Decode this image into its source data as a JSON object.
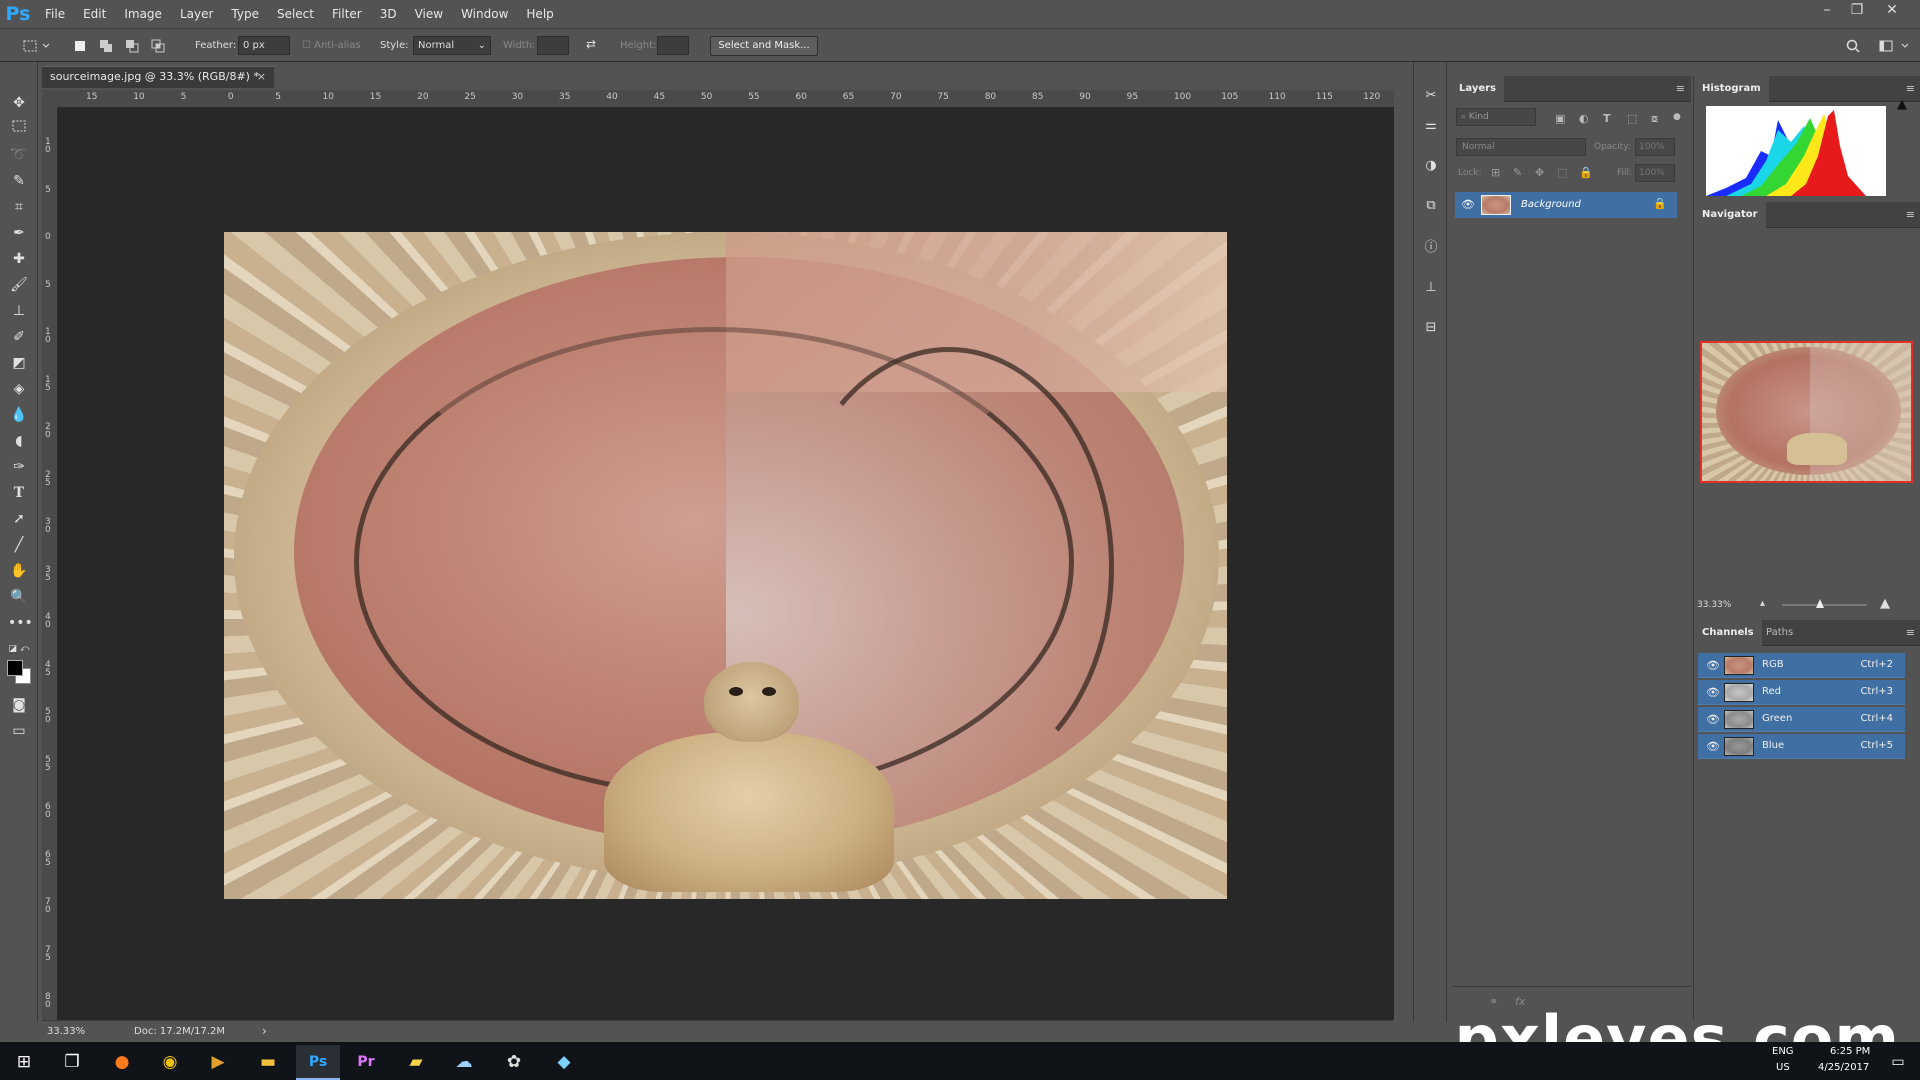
{
  "app": {
    "logo": "Ps",
    "menu": [
      "File",
      "Edit",
      "Image",
      "Layer",
      "Type",
      "Select",
      "Filter",
      "3D",
      "View",
      "Window",
      "Help"
    ],
    "window_controls": {
      "minimize": "–",
      "restore": "❐",
      "close": "✕"
    }
  },
  "options": {
    "feather_label": "Feather:",
    "feather_value": "0 px",
    "antialias_label": "Anti-alias",
    "style_label": "Style:",
    "style_value": "Normal",
    "width_label": "Width:",
    "height_label": "Height:",
    "select_mask_label": "Select and Mask..."
  },
  "document": {
    "tab_title": "sourceimage.jpg @ 33.3% (RGB/8#) *",
    "tab_close": "×"
  },
  "ruler_h": [
    "15",
    "10",
    "5",
    "0",
    "5",
    "10",
    "15",
    "20",
    "25",
    "30",
    "35",
    "40",
    "45",
    "50",
    "55",
    "60",
    "65",
    "70",
    "75",
    "80",
    "85",
    "90",
    "95",
    "100",
    "105",
    "110",
    "115",
    "120"
  ],
  "ruler_v": [
    "1 0",
    "5",
    "0",
    "5",
    "1 0",
    "1 5",
    "2 0",
    "2 5",
    "3 0",
    "3 5",
    "4 0",
    "4 5",
    "5 0",
    "5 5",
    "6 0",
    "6 5",
    "7 0",
    "7 5",
    "8 0"
  ],
  "layers_panel": {
    "tab": "Layers",
    "kind_placeholder": "Kind",
    "blend_mode": "Normal",
    "opacity_label": "Opacity:",
    "opacity_value": "100%",
    "lock_label": "Lock:",
    "fill_label": "Fill:",
    "fill_value": "100%",
    "layers": [
      {
        "name": "Background"
      }
    ]
  },
  "histogram_panel": {
    "tab": "Histogram",
    "warning": "▲"
  },
  "navigator_panel": {
    "tab": "Navigator",
    "zoom": "33.33%"
  },
  "channels_panel": {
    "tabs": [
      "Channels",
      "Paths"
    ],
    "channels": [
      {
        "name": "RGB",
        "shortcut": "Ctrl+2"
      },
      {
        "name": "Red",
        "shortcut": "Ctrl+3"
      },
      {
        "name": "Green",
        "shortcut": "Ctrl+4"
      },
      {
        "name": "Blue",
        "shortcut": "Ctrl+5"
      }
    ]
  },
  "status": {
    "zoom": "33.33%",
    "doc": "Doc: 17.2M/17.2M",
    "arrow": "›"
  },
  "taskbar": {
    "lang": "ENG",
    "region": "US",
    "time": "6:25 PM",
    "date": "4/25/2017"
  },
  "watermark": "pxleyes.com",
  "colors": {
    "accent_blue": "#3f6fa3",
    "nav_frame": "#e0302c",
    "ps_blue": "#31a8ff"
  }
}
